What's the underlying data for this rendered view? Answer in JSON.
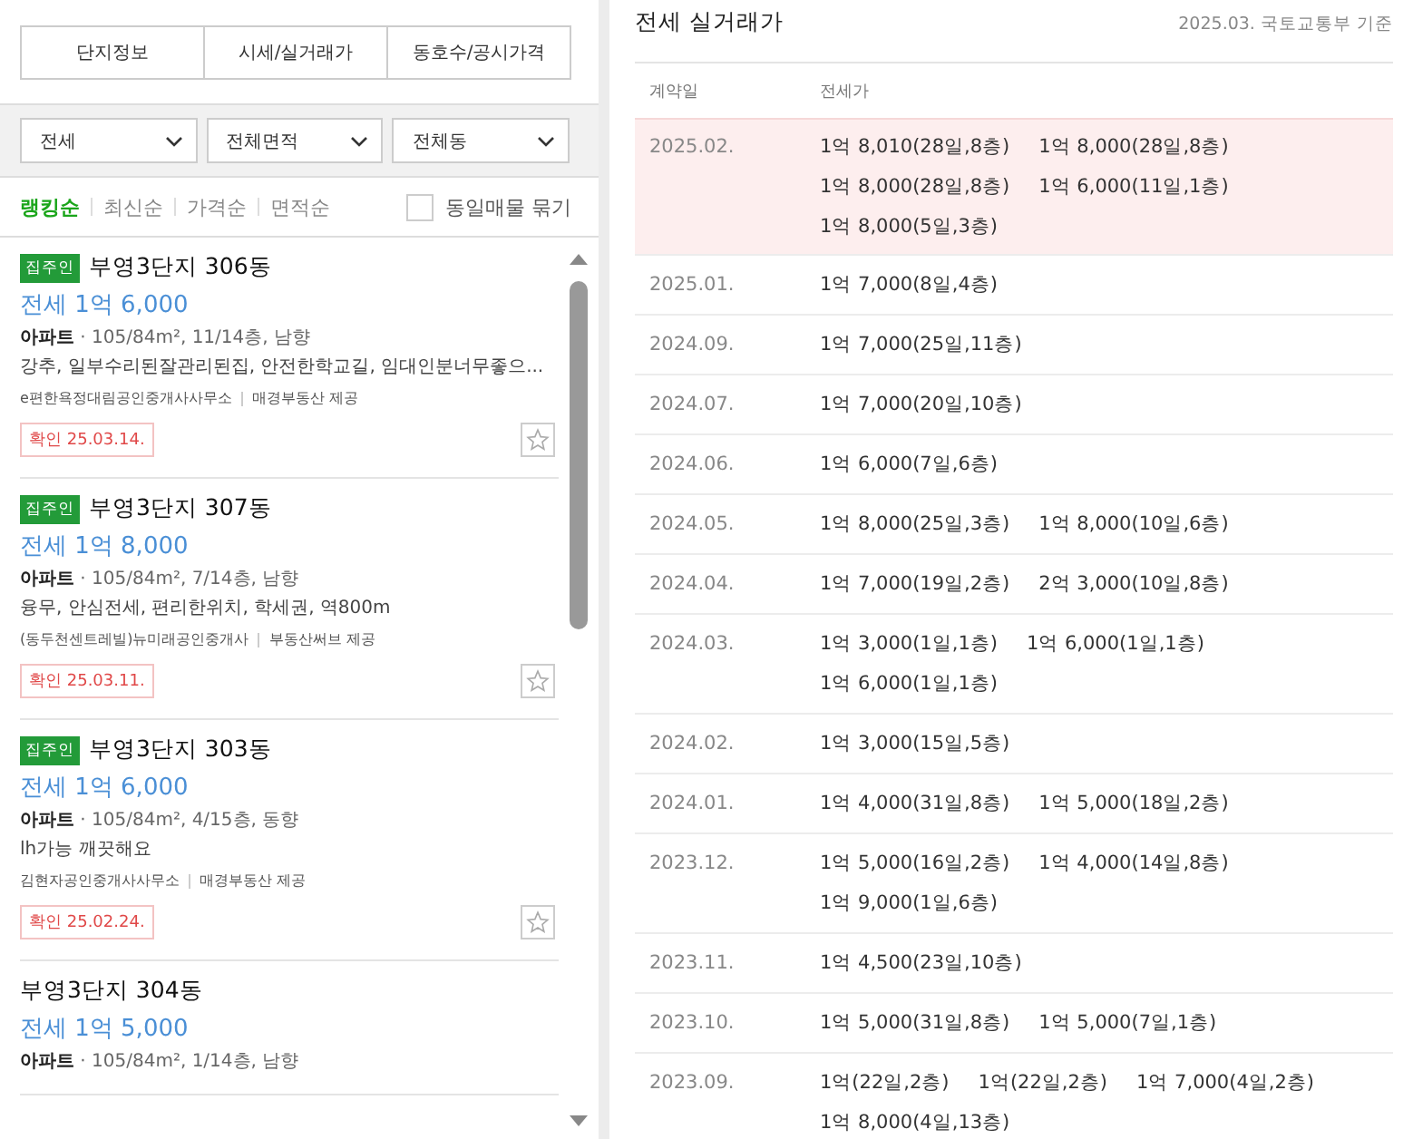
{
  "top_tabs": [
    {
      "label": "단지정보",
      "selected": false
    },
    {
      "label": "시세/실거래가",
      "selected": false
    },
    {
      "label": "동호수/공시가격",
      "selected": false
    }
  ],
  "filters": [
    {
      "label": "전세"
    },
    {
      "label": "전체면적"
    },
    {
      "label": "전체동"
    }
  ],
  "sort_options": [
    {
      "label": "랭킹순",
      "selected": true
    },
    {
      "label": "최신순",
      "selected": false
    },
    {
      "label": "가격순",
      "selected": false
    },
    {
      "label": "면적순",
      "selected": false
    }
  ],
  "group_same": {
    "label": "동일매물 묶기",
    "checked": false
  },
  "listings": [
    {
      "badge": "집주인",
      "title": "부영3단지 306동",
      "price": "전세 1억 6,000",
      "spec": "**아파트** · 105/84m², 11/14층, 남향",
      "description": "강추, 일부수리된잘관리된집, 안전한학교길, 임대인분너무좋으...",
      "agency": "e편한욕정대림공인중개사사무소",
      "provider": "매경부동산 제공",
      "confirmed": "확인 25.03.14.",
      "favorite": false
    },
    {
      "badge": "집주인",
      "title": "부영3단지 307동",
      "price": "전세 1억 8,000",
      "spec": "**아파트** · 105/84m², 7/14층, 남향",
      "description": "융무, 안심전세, 편리한위치, 학세권, 역800m",
      "agency": "(동두천센트레빌)뉴미래공인중개사",
      "provider": "부동산써브 제공",
      "confirmed": "확인 25.03.11.",
      "favorite": false
    },
    {
      "badge": "집주인",
      "title": "부영3단지 303동",
      "price": "전세 1억 6,000",
      "spec": "**아파트** · 105/84m², 4/15층, 동향",
      "description": "lh가능 깨끗해요",
      "agency": "김현자공인중개사사무소",
      "provider": "매경부동산 제공",
      "confirmed": "확인 25.02.24.",
      "favorite": false
    },
    {
      "title": "부영3단지 304동",
      "price": "전세 1억 5,000",
      "spec": "**아파트** · 105/84m², 1/14층, 남향"
    }
  ],
  "panel": {
    "title": "전세 실거래가",
    "source": "2025.03. 국토교통부 기준"
  },
  "table": {
    "columns": [
      "계약일",
      "전세가"
    ],
    "rows": [
      {
        "date": "2025.02.",
        "highlighted": true,
        "deals": [
          "1억 8,010(28일,8층)",
          "1억 8,000(28일,8층)",
          "1억 8,000(28일,8층)",
          "1억 6,000(11일,1층)",
          "1억 8,000(5일,3층)"
        ]
      },
      {
        "date": "2025.01.",
        "highlighted": false,
        "deals": [
          "1억 7,000(8일,4층)"
        ]
      },
      {
        "date": "2024.09.",
        "highlighted": false,
        "deals": [
          "1억 7,000(25일,11층)"
        ]
      },
      {
        "date": "2024.07.",
        "highlighted": false,
        "deals": [
          "1억 7,000(20일,10층)"
        ]
      },
      {
        "date": "2024.06.",
        "highlighted": false,
        "deals": [
          "1억 6,000(7일,6층)"
        ]
      },
      {
        "date": "2024.05.",
        "highlighted": false,
        "deals": [
          "1억 8,000(25일,3층)",
          "1억 8,000(10일,6층)"
        ]
      },
      {
        "date": "2024.04.",
        "highlighted": false,
        "deals": [
          "1억 7,000(19일,2층)",
          "2억 3,000(10일,8층)"
        ]
      },
      {
        "date": "2024.03.",
        "highlighted": false,
        "deals": [
          "1억 3,000(1일,1층)",
          "1억 6,000(1일,1층)",
          "1억 6,000(1일,1층)"
        ]
      },
      {
        "date": "2024.02.",
        "highlighted": false,
        "deals": [
          "1억 3,000(15일,5층)"
        ]
      },
      {
        "date": "2024.01.",
        "highlighted": false,
        "deals": [
          "1억 4,000(31일,8층)",
          "1억 5,000(18일,2층)"
        ]
      },
      {
        "date": "2023.12.",
        "highlighted": false,
        "deals": [
          "1억 5,000(16일,2층)",
          "1억 4,000(14일,8층)",
          "1억 9,000(1일,6층)"
        ]
      },
      {
        "date": "2023.11.",
        "highlighted": false,
        "deals": [
          "1억 4,500(23일,10층)"
        ]
      },
      {
        "date": "2023.10.",
        "highlighted": false,
        "deals": [
          "1억 5,000(31일,8층)",
          "1억 5,000(7일,1층)"
        ]
      },
      {
        "date": "2023.09.",
        "highlighted": false,
        "deals": [
          "1억(22일,2층)",
          "1억(22일,2층)",
          "1억 7,000(4일,2층)",
          "1억 8,000(4일,13층)"
        ]
      }
    ]
  }
}
